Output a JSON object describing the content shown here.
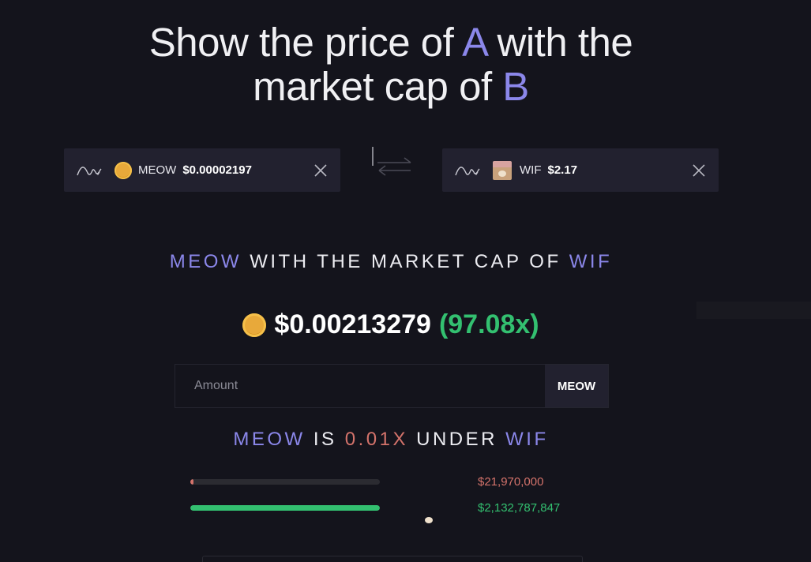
{
  "headline": {
    "part1": "Show the price of ",
    "a": "A",
    "part2": " with the",
    "part3": "market cap of ",
    "b": "B"
  },
  "token_a": {
    "symbol": "MEOW",
    "price": "$0.00002197"
  },
  "token_b": {
    "symbol": "WIF",
    "price": "$2.17"
  },
  "result": {
    "heading_a": "MEOW",
    "heading_mid": " WITH THE MARKET CAP OF ",
    "heading_b": "WIF",
    "price": "$0.00213279",
    "multiplier": "(97.08x)"
  },
  "amount": {
    "placeholder": "Amount",
    "unit": "MEOW"
  },
  "comparison": {
    "a": "MEOW",
    "is": " IS ",
    "factor": "0.01X",
    "under": " UNDER ",
    "b": "WIF",
    "rows": [
      {
        "value": "$21,970,000",
        "fill_fraction": 0.0103
      },
      {
        "value": "$2,132,787,847",
        "fill_fraction": 1.0
      }
    ]
  },
  "colors": {
    "accent": "#8b87ea",
    "positive": "#33c070",
    "negative": "#d4736b",
    "background": "#14141c"
  }
}
